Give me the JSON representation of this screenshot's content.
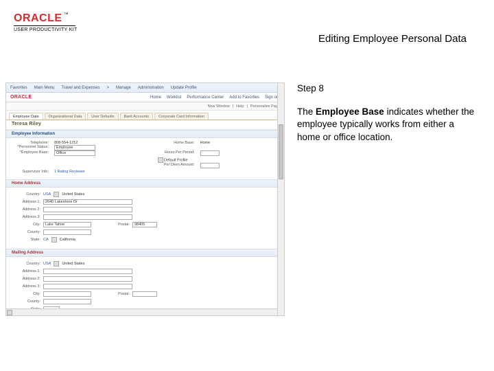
{
  "header": {
    "brand": "ORACLE",
    "tm": "™",
    "subbrand": "USER PRODUCTIVITY KIT",
    "title": "Editing Employee Personal Data"
  },
  "side": {
    "step": "Step 8",
    "text_pre": "The ",
    "text_bold": "Employee Base",
    "text_post": " indicates whether the employee typically works from either a home or office location."
  },
  "ss": {
    "nav": {
      "i1": "Favorites",
      "i2": "Main Menu",
      "i3": "Travel and Expenses",
      "arrow": ">",
      "i4": "Manage",
      "i5": "Administration",
      "i6": "Update Profile"
    },
    "inner_brand": "ORACLE",
    "bar2": {
      "home": "Home",
      "worklist": "Worklist",
      "perf": "Performance Center",
      "addfav": "Add to Favorites",
      "signout": "Sign out"
    },
    "bar3": {
      "newwin": "New Window",
      "help": "Help",
      "personalize": "Personalize Page"
    },
    "tabs": {
      "t1": "Employee Data",
      "t2": "Organizational Data",
      "t3": "User Defaults",
      "t4": "Bank Accounts",
      "t5": "Corporate Card Information"
    },
    "person": "Teresa Riley",
    "section_emp": "Employee Information",
    "emp": {
      "r1l": "Telephone:",
      "r1v": "808-554-1212",
      "r1rl": "Home Base:",
      "r1rv": "Home",
      "r2l": "*Personnel Status:",
      "r2v": "Employee",
      "r3l": "*Employee Base:",
      "r3v": "Office",
      "r3rl": "Hours Per Period:",
      "r4rl_a": "Default Profile",
      "r4rl_b": "Per Diem Amount:",
      "r5l": "Supervisor Info:",
      "r5v": "1 Rating Reviewer"
    },
    "section_home": "Home Address",
    "home": {
      "country_l": "Country:",
      "country_v": "USA",
      "country_link": "United States",
      "a1_l": "Address 1:",
      "a1_v": "2640 Lakeshore Dr",
      "a2_l": "Address 2:",
      "a3_l": "Address 3:",
      "city_l": "City:",
      "city_v": "Lake Tahoe",
      "postal_l": "Postal:",
      "postal_v": "98405",
      "county_l": "County:",
      "state_l": "State:",
      "state_v": "CA",
      "state_link": "California"
    },
    "section_mail": "Mailing Address",
    "mail": {
      "country_l": "Country:",
      "country_v": "USA",
      "country_link": "United States",
      "a1_l": "Address 1:",
      "a2_l": "Address 2:",
      "a3_l": "Address 3:",
      "city_l": "City:",
      "postal_l": "Postal:",
      "county_l": "County:",
      "state_l": "State:"
    }
  }
}
